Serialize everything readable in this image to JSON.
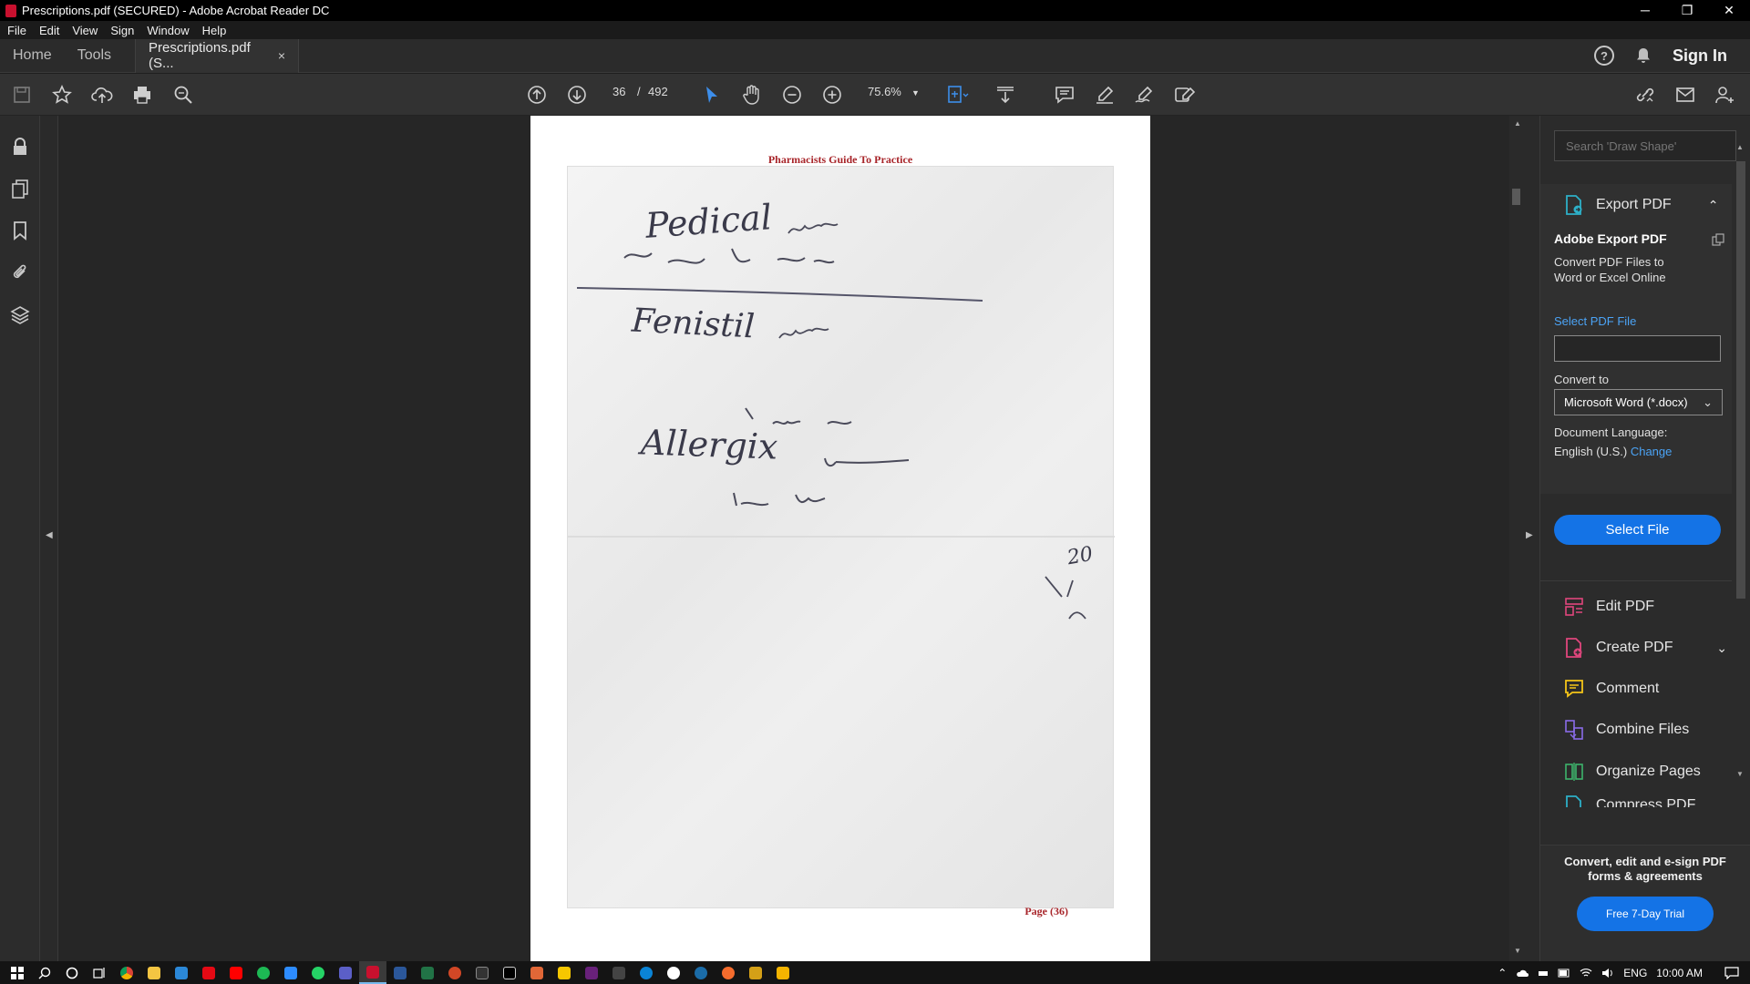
{
  "window": {
    "title": "Prescriptions.pdf (SECURED) - Adobe Acrobat Reader DC",
    "minimize": "─",
    "restore": "❐",
    "close": "✕"
  },
  "menu": [
    "File",
    "Edit",
    "View",
    "Sign",
    "Window",
    "Help"
  ],
  "tabs": {
    "home": "Home",
    "tools": "Tools",
    "document": "Prescriptions.pdf (S...",
    "close": "×"
  },
  "header_right": {
    "help": "?",
    "sign_in": "Sign In"
  },
  "toolbar": {
    "page_current": "36",
    "page_separator": "/",
    "page_total": "492",
    "zoom": "75.6%"
  },
  "document": {
    "header": "Pharmacists Guide To Practice",
    "page_label": "Page (36)",
    "handwriting": [
      "Pedical",
      "Fenistil",
      "Allergix",
      "20"
    ]
  },
  "right_pane": {
    "search_placeholder": "Search 'Draw Shape'",
    "export_pdf": {
      "title": "Export PDF",
      "card_title": "Adobe Export PDF",
      "description": "Convert PDF Files to Word or Excel Online",
      "select_pdf_file": "Select PDF File",
      "convert_to_label": "Convert to",
      "convert_to_value": "Microsoft Word (*.docx)",
      "language_label": "Document Language:",
      "language_value": "English (U.S.)",
      "change": "Change",
      "select_file_button": "Select File"
    },
    "tools": [
      {
        "label": "Edit PDF",
        "color": "#e0467d"
      },
      {
        "label": "Create PDF",
        "color": "#e0467d"
      },
      {
        "label": "Comment",
        "color": "#f5c518"
      },
      {
        "label": "Combine Files",
        "color": "#8a6ce8"
      },
      {
        "label": "Organize Pages",
        "color": "#3db36b"
      },
      {
        "label": "Compress PDF",
        "color": "#2db0c8"
      }
    ],
    "promo": "Convert, edit and e-sign PDF forms & agreements",
    "trial_button": "Free 7-Day Trial"
  },
  "taskbar": {
    "language": "ENG",
    "time": "10:00 AM"
  }
}
